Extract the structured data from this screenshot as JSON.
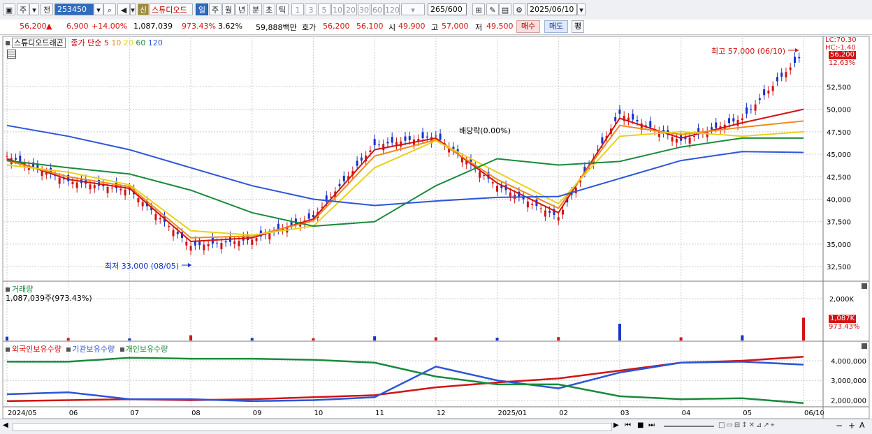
{
  "toolbar": {
    "market_label": "주",
    "prev_label": "전",
    "code_value": "253450",
    "new_label": "신",
    "stock_name": "스튜디오드",
    "periods": [
      "일",
      "주",
      "월",
      "년",
      "분",
      "초",
      "틱"
    ],
    "active_period": "일",
    "intervals": [
      "1",
      "3",
      "5",
      "10",
      "20",
      "30",
      "60",
      "120"
    ],
    "count": "265",
    "count_max": "/600",
    "date": "2025/06/10"
  },
  "quote": {
    "price": "56,200",
    "up_arrow": "▲",
    "change": "6,900",
    "change_pct": "+14.00%",
    "volume": "1,087,039",
    "volume_ratio": "973.43%",
    "turnover": "3.62%",
    "amount": "59,888백만",
    "bid_label": "호가",
    "bid": "56,200",
    "ask": "56,100",
    "open_label": "시",
    "open": "49,900",
    "high_label": "고",
    "high": "57,000",
    "low_label": "저",
    "low": "49,500",
    "buy_label": "매수",
    "sell_label": "매도",
    "avg_label": "평"
  },
  "price_panel": {
    "stock_tab": "스튜디오드래곤",
    "legend_title": "종가 단순",
    "ma_labels": [
      "5",
      "10",
      "20",
      "60",
      "120"
    ],
    "ma_colors": [
      "#d21414",
      "#f08a1c",
      "#e8d21c",
      "#1a8a3c",
      "#2d55d8"
    ],
    "lc_label": "LC:70.30",
    "hc_label": "HC:-1.40",
    "last_price_tag": "56,200",
    "pct_tag": "12.63%",
    "high_note": "최고 57,000 (06/10)",
    "low_note": "최저 33,000 (08/05)",
    "event_note": "배당락(0.00%)"
  },
  "volume_panel": {
    "title": "거래량",
    "value_text": "1,087,039주(973.43%)",
    "tag": "1,087K",
    "pct_tag": "973.43%"
  },
  "holdings_panel": {
    "series_labels": [
      "외국인보유수량",
      "기관보유수량",
      "개인보유수량"
    ],
    "series_colors": [
      "#d21414",
      "#2d55d8",
      "#1a8a3c"
    ]
  },
  "chart_data": [
    {
      "type": "line",
      "title": "",
      "x": [
        "2024/05",
        "2024/06",
        "2024/07",
        "2024/08",
        "2024/09",
        "2024/10",
        "2024/11",
        "2024/12",
        "2025/01",
        "2025/02",
        "2025/03",
        "2025/04",
        "2025/05",
        "2025/06"
      ],
      "x_ticks": [
        "2024/05",
        "06",
        "07",
        "08",
        "09",
        "10",
        "11",
        "12",
        "2025/01",
        "02",
        "03",
        "04",
        "05",
        "06/10"
      ],
      "y_ticks": [
        "32,500",
        "35,000",
        "37,500",
        "40,000",
        "42,500",
        "45,000",
        "47,500",
        "50,000",
        "52,500"
      ],
      "ylim": [
        31500,
        57500
      ],
      "series": [
        {
          "name": "종가",
          "values": [
            44800,
            42000,
            41000,
            34800,
            35500,
            38000,
            46000,
            47000,
            41500,
            38000,
            49500,
            46500,
            49000,
            56200
          ]
        },
        {
          "name": "5",
          "values": [
            44500,
            42200,
            41200,
            35300,
            35700,
            37800,
            45500,
            46800,
            41800,
            38500,
            49000,
            46800,
            48500,
            50000
          ]
        },
        {
          "name": "10",
          "values": [
            44300,
            42500,
            41400,
            35700,
            35900,
            37600,
            44800,
            46600,
            42200,
            39000,
            48200,
            47200,
            48000,
            48700
          ]
        },
        {
          "name": "20",
          "values": [
            43800,
            43000,
            41600,
            36500,
            36000,
            37000,
            43500,
            46500,
            43000,
            39500,
            47000,
            47500,
            47000,
            47500
          ]
        },
        {
          "name": "60",
          "values": [
            44300,
            43500,
            42800,
            41000,
            38500,
            37000,
            37500,
            41500,
            44500,
            43800,
            44200,
            45800,
            46800,
            46800
          ]
        },
        {
          "name": "120",
          "values": [
            48200,
            47000,
            45500,
            43500,
            41500,
            40000,
            39300,
            39800,
            40200,
            40300,
            42300,
            44300,
            45300,
            45200
          ]
        }
      ]
    },
    {
      "type": "bar",
      "title": "거래량",
      "categories": [
        "2024/05",
        "2024/06",
        "2024/07",
        "2024/08",
        "2024/09",
        "2024/10",
        "2024/11",
        "2024/12",
        "2025/01",
        "2025/02",
        "2025/03",
        "2025/04",
        "2025/05",
        "2025/06"
      ],
      "values": [
        180000,
        120000,
        100000,
        250000,
        120000,
        110000,
        200000,
        150000,
        130000,
        160000,
        800000,
        150000,
        250000,
        1087039
      ],
      "y_ticks": [
        "2,000K"
      ],
      "ylim": [
        0,
        2600000
      ]
    },
    {
      "type": "line",
      "title": "보유수량",
      "x": [
        "2024/05",
        "2024/06",
        "2024/07",
        "2024/08",
        "2024/09",
        "2024/10",
        "2024/11",
        "2024/12",
        "2025/01",
        "2025/02",
        "2025/03",
        "2025/04",
        "2025/05",
        "2025/06"
      ],
      "y_ticks": [
        "2,000,000",
        "3,000,000",
        "4,000,000"
      ],
      "ylim": [
        1700000,
        4600000
      ],
      "series": [
        {
          "name": "외국인보유수량",
          "values": [
            1950000,
            2000000,
            2050000,
            2000000,
            2050000,
            2150000,
            2250000,
            2650000,
            2900000,
            3100000,
            3500000,
            3900000,
            4000000,
            4200000
          ]
        },
        {
          "name": "기관보유수량",
          "values": [
            2300000,
            2400000,
            2050000,
            2050000,
            1950000,
            2000000,
            2150000,
            3700000,
            3000000,
            2600000,
            3400000,
            3900000,
            3950000,
            3800000
          ]
        },
        {
          "name": "개인보유수량",
          "values": [
            3950000,
            3950000,
            4150000,
            4100000,
            4100000,
            4050000,
            3900000,
            3200000,
            2800000,
            2800000,
            2200000,
            2050000,
            2100000,
            1850000
          ]
        }
      ]
    }
  ]
}
